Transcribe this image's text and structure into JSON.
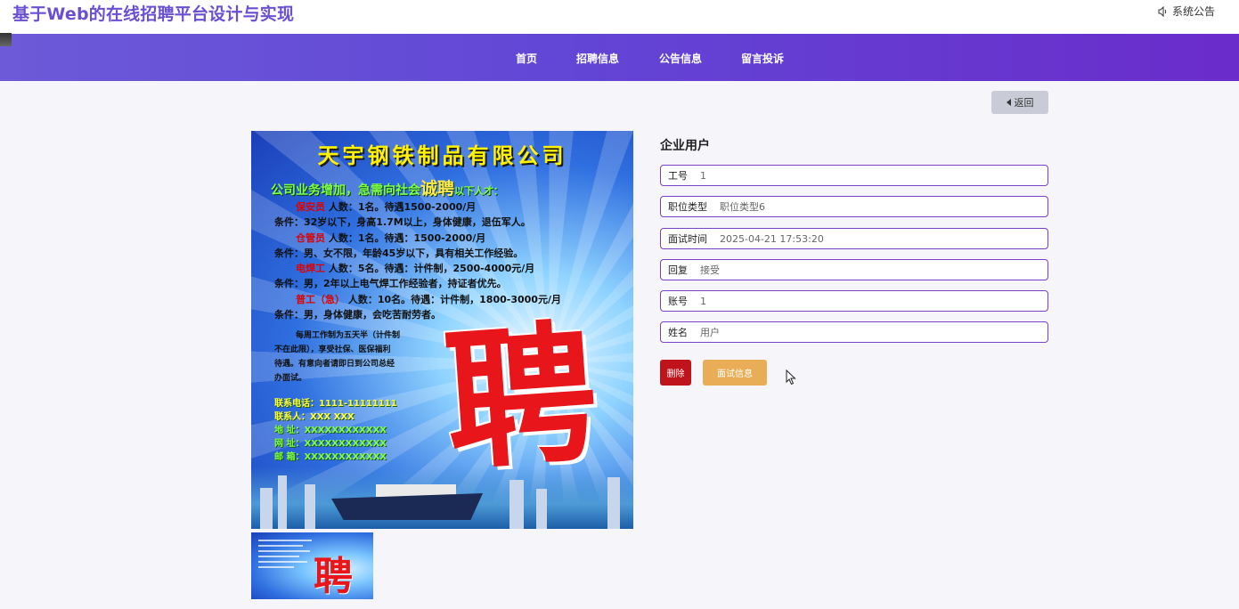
{
  "header": {
    "site_title": "基于Web的在线招聘平台设计与实现",
    "notice_label": "系统公告"
  },
  "nav": {
    "items": [
      "首页",
      "招聘信息",
      "公告信息",
      "留言投诉"
    ]
  },
  "back_button": {
    "label": "返回"
  },
  "poster": {
    "company": "天宇钢铁制品有限公司",
    "subtitle_pre": "公司业务增加，急需向社会",
    "subtitle_big": "诚聘",
    "subtitle_post": "以下人才：",
    "lines": [
      {
        "red": "保安员",
        "text": "人数：1名。待遇1500-2000/月"
      },
      {
        "red": "",
        "text": "条件：32岁以下，身高1.7M以上，身体健康，退伍军人。"
      },
      {
        "red": "仓管员",
        "text": "人数：1名。待遇：1500-2000/月"
      },
      {
        "red": "",
        "text": "条件：男、女不限，年龄45岁以下，具有相关工作经验。"
      },
      {
        "red": "电焊工",
        "text": "人数：5名。待遇：计件制，2500-4000元/月"
      },
      {
        "red": "",
        "text": "条件：男，2年以上电气焊工作经验者，持证者优先。"
      },
      {
        "red": "普工（急）",
        "text": "人数：10名。待遇：计件制，1800-3000元/月"
      },
      {
        "red": "",
        "text": "条件：男，身体健康，会吃苦耐劳者。"
      }
    ],
    "benefits": [
      "每周工作制为五天半（计件制",
      "不在此限），享受社保、医保福利",
      "待遇。有意向者请即日到公司总经",
      "办面试。"
    ],
    "contacts": [
      "联系电话：1111-11111111",
      "联系人：XXX  XXX",
      "地   址：XXXXXXXXXXXX",
      "网   址：XXXXXXXXXXXX",
      "邮   箱：XXXXXXXXXXXX"
    ],
    "big_char": "聘"
  },
  "detail": {
    "section_title": "企业用户",
    "fields": [
      {
        "label": "工号",
        "value": "1"
      },
      {
        "label": "职位类型",
        "value": "职位类型6"
      },
      {
        "label": "面试时间",
        "value": "2025-04-21 17:53:20"
      },
      {
        "label": "回复",
        "value": "接受"
      },
      {
        "label": "账号",
        "value": "1"
      },
      {
        "label": "姓名",
        "value": "用户"
      }
    ],
    "delete_label": "删除",
    "interview_label": "面试信息"
  }
}
